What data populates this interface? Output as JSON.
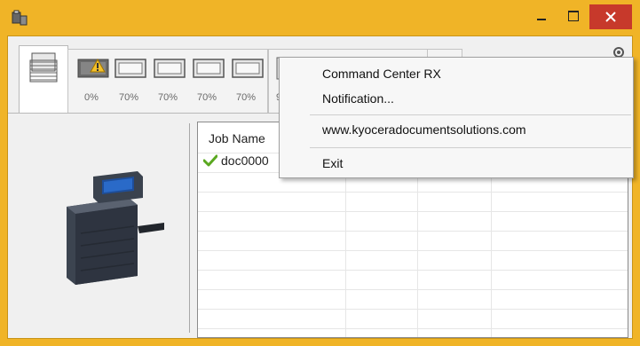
{
  "window": {
    "title": "",
    "accent_color": "#f0b427",
    "close_color": "#c7392b"
  },
  "tabs": {
    "trays": [
      {
        "level": "0%",
        "warning": true
      },
      {
        "level": "70%",
        "warning": false
      },
      {
        "level": "70%",
        "warning": false
      },
      {
        "level": "70%",
        "warning": false
      },
      {
        "level": "70%",
        "warning": false
      }
    ],
    "partial_label": "9"
  },
  "job_list": {
    "column_header": "Job Name",
    "rows": [
      {
        "name": "doc0000",
        "status_icon": "check-icon"
      }
    ]
  },
  "context_menu": {
    "items": [
      {
        "label": "Command Center RX"
      },
      {
        "label": "Notification..."
      },
      {
        "label": "www.kyoceradocumentsolutions.com"
      },
      {
        "label": "Exit"
      }
    ]
  }
}
